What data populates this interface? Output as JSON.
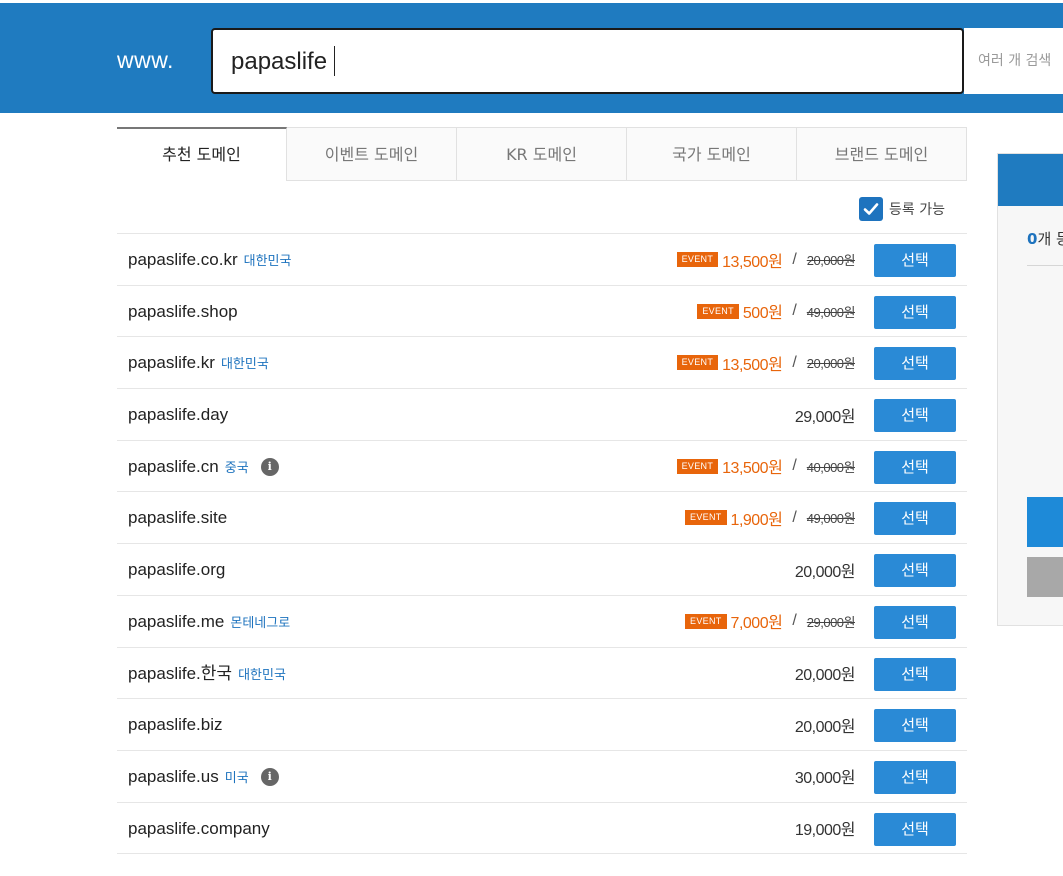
{
  "header": {
    "prefix": "www.",
    "search_value": "papaslife",
    "multi_search_label": "여러 개 검색"
  },
  "tabs": [
    {
      "label": "추천 도메인",
      "active": true
    },
    {
      "label": "이벤트 도메인",
      "active": false
    },
    {
      "label": "KR 도메인",
      "active": false
    },
    {
      "label": "국가 도메인",
      "active": false
    },
    {
      "label": "브랜드 도메인",
      "active": false
    }
  ],
  "filter": {
    "label": "등록 가능",
    "checked": true
  },
  "event_badge": "EVENT",
  "select_label": "선택",
  "domains": [
    {
      "name": "papaslife.co.kr",
      "country": "대한민국",
      "info": false,
      "event": true,
      "price": "13,500원",
      "orig": "20,000원"
    },
    {
      "name": "papaslife.shop",
      "country": "",
      "info": false,
      "event": true,
      "price": "500원",
      "orig": "49,000원"
    },
    {
      "name": "papaslife.kr",
      "country": "대한민국",
      "info": false,
      "event": true,
      "price": "13,500원",
      "orig": "20,000원"
    },
    {
      "name": "papaslife.day",
      "country": "",
      "info": false,
      "event": false,
      "price": "29,000원",
      "orig": ""
    },
    {
      "name": "papaslife.cn",
      "country": "중국",
      "info": true,
      "event": true,
      "price": "13,500원",
      "orig": "40,000원"
    },
    {
      "name": "papaslife.site",
      "country": "",
      "info": false,
      "event": true,
      "price": "1,900원",
      "orig": "49,000원"
    },
    {
      "name": "papaslife.org",
      "country": "",
      "info": false,
      "event": false,
      "price": "20,000원",
      "orig": ""
    },
    {
      "name": "papaslife.me",
      "country": "몬테네그로",
      "info": false,
      "event": true,
      "price": "7,000원",
      "orig": "29,000원"
    },
    {
      "name": "papaslife.한국",
      "country": "대한민국",
      "info": false,
      "event": false,
      "price": "20,000원",
      "orig": ""
    },
    {
      "name": "papaslife.biz",
      "country": "",
      "info": false,
      "event": false,
      "price": "20,000원",
      "orig": ""
    },
    {
      "name": "papaslife.us",
      "country": "미국",
      "info": true,
      "event": false,
      "price": "30,000원",
      "orig": ""
    },
    {
      "name": "papaslife.company",
      "country": "",
      "info": false,
      "event": false,
      "price": "19,000원",
      "orig": ""
    }
  ],
  "cart": {
    "count": "0",
    "count_suffix": "개 등"
  },
  "colors": {
    "brand_blue": "#1f7bc0",
    "button_blue": "#2a8ad6",
    "event_orange": "#e8650b"
  }
}
